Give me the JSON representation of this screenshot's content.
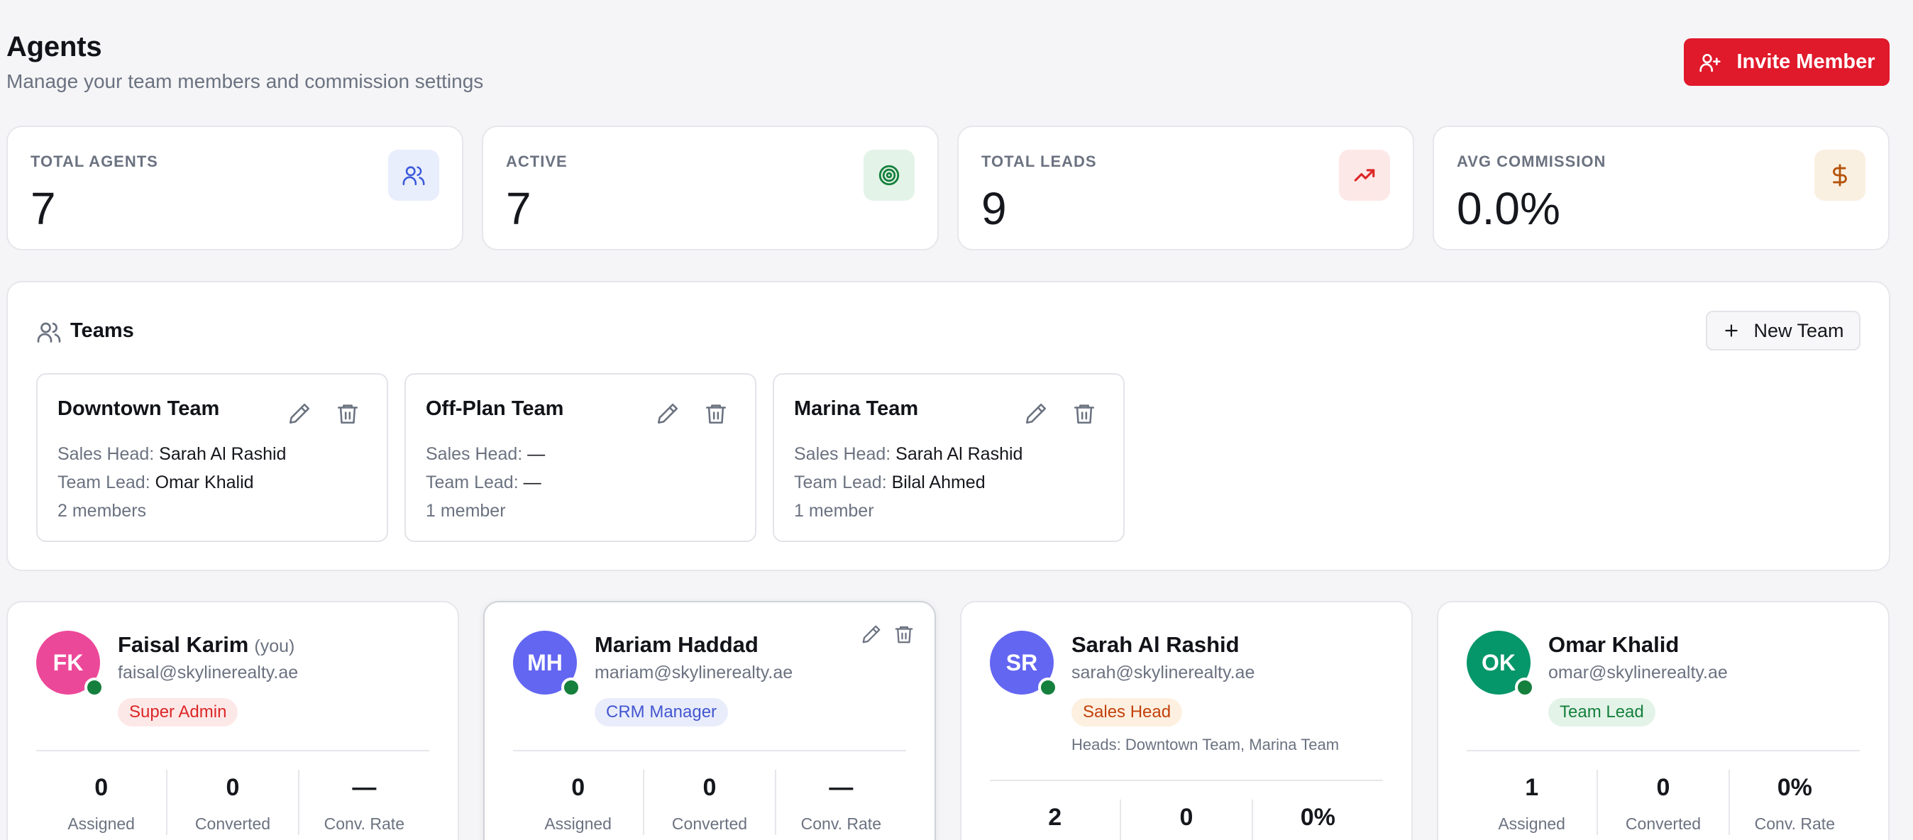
{
  "header": {
    "title": "Agents",
    "subtitle": "Manage your team members and commission settings",
    "invite_label": "Invite Member"
  },
  "stats": [
    {
      "label": "TOTAL AGENTS",
      "value": "7",
      "icon": "users-icon",
      "color": "#3b5bdb",
      "bg": "#e9eefc"
    },
    {
      "label": "ACTIVE",
      "value": "7",
      "icon": "target-icon",
      "color": "#15803d",
      "bg": "#e3f3e8"
    },
    {
      "label": "TOTAL LEADS",
      "value": "9",
      "icon": "trending-up-icon",
      "color": "#dc2626",
      "bg": "#fde8e8"
    },
    {
      "label": "AVG COMMISSION",
      "value": "0.0%",
      "icon": "dollar-icon",
      "color": "#b45309",
      "bg": "#faf0e2"
    }
  ],
  "teams": {
    "title": "Teams",
    "new_team_label": "New Team",
    "sales_head_label": "Sales Head:",
    "team_lead_label": "Team Lead:",
    "items": [
      {
        "name": "Downtown Team",
        "sales_head": "Sarah Al Rashid",
        "team_lead": "Omar Khalid",
        "members": "2 members"
      },
      {
        "name": "Off-Plan Team",
        "sales_head": "—",
        "team_lead": "—",
        "members": "1 member"
      },
      {
        "name": "Marina Team",
        "sales_head": "Sarah Al Rashid",
        "team_lead": "Bilal Ahmed",
        "members": "1 member"
      }
    ]
  },
  "agents": [
    {
      "initials": "FK",
      "name": "Faisal Karim",
      "you": "(you)",
      "email": "faisal@skylinerealty.ae",
      "role": "Super Admin",
      "role_color": "#dc2626",
      "role_bg": "#fde8e8",
      "avatar_color": "#ec4899",
      "heads": "",
      "assigned": "0",
      "converted": "0",
      "rate": "—"
    },
    {
      "initials": "MH",
      "name": "Mariam Haddad",
      "you": "",
      "email": "mariam@skylinerealty.ae",
      "role": "CRM Manager",
      "role_color": "#4356d0",
      "role_bg": "#e9edfb",
      "avatar_color": "#6366f1",
      "heads": "",
      "assigned": "0",
      "converted": "0",
      "rate": "—"
    },
    {
      "initials": "SR",
      "name": "Sarah Al Rashid",
      "you": "",
      "email": "sarah@skylinerealty.ae",
      "role": "Sales Head",
      "role_color": "#c2410c",
      "role_bg": "#fdf0e0",
      "avatar_color": "#6366f1",
      "heads": "Heads: Downtown Team, Marina Team",
      "assigned": "2",
      "converted": "0",
      "rate": "0%"
    },
    {
      "initials": "OK",
      "name": "Omar Khalid",
      "you": "",
      "email": "omar@skylinerealty.ae",
      "role": "Team Lead",
      "role_color": "#15803d",
      "role_bg": "#e3f3e8",
      "avatar_color": "#059669",
      "heads": "",
      "assigned": "1",
      "converted": "0",
      "rate": "0%"
    }
  ],
  "stat_labels": {
    "assigned": "Assigned",
    "converted": "Converted",
    "rate": "Conv. Rate"
  }
}
